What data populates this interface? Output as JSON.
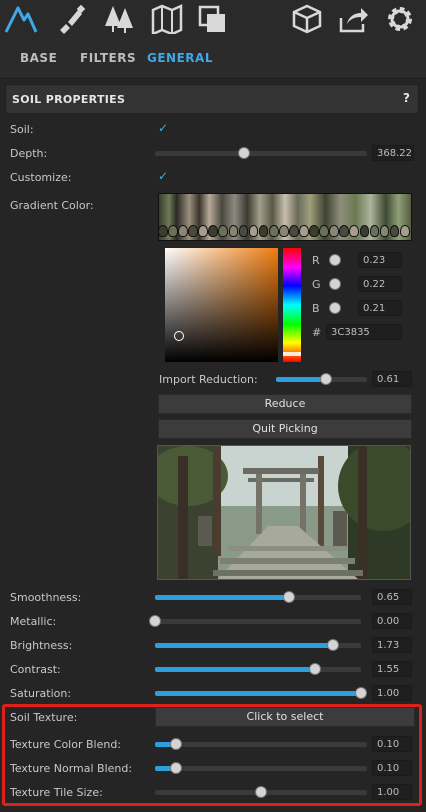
{
  "toolbar": {
    "icons": [
      "terrain-icon",
      "brush-icon",
      "trees-icon",
      "map-icon",
      "layers-icon",
      "cube-icon",
      "share-icon",
      "gear-icon"
    ]
  },
  "tabs": [
    {
      "label": "BASE",
      "active": false
    },
    {
      "label": "FILTERS",
      "active": false
    },
    {
      "label": "GENERAL",
      "active": true
    }
  ],
  "section": {
    "title": "SOIL PROPERTIES",
    "help": "?"
  },
  "soil": {
    "label": "Soil:",
    "checked": true
  },
  "depth": {
    "label": "Depth:",
    "value": "368.22",
    "fraction": 0.42
  },
  "customize": {
    "label": "Customize:",
    "checked": true
  },
  "gradient": {
    "label": "Gradient Color:"
  },
  "color": {
    "r_label": "R",
    "r": "0.23",
    "g_label": "G",
    "g": "0.22",
    "b_label": "B",
    "b": "0.21",
    "hex_label": "#",
    "hex": "3C3835"
  },
  "import_reduction": {
    "label": "Import Reduction:",
    "value": "0.61",
    "fraction": 0.55
  },
  "buttons": {
    "reduce": "Reduce",
    "quit": "Quit Picking"
  },
  "material": [
    {
      "label": "Smoothness:",
      "value": "0.65",
      "fraction": 0.65
    },
    {
      "label": "Metallic:",
      "value": "0.00",
      "fraction": 0.0
    },
    {
      "label": "Brightness:",
      "value": "1.73",
      "fraction": 0.865
    },
    {
      "label": "Contrast:",
      "value": "1.55",
      "fraction": 0.775
    },
    {
      "label": "Saturation:",
      "value": "1.00",
      "fraction": 1.0
    }
  ],
  "texture": {
    "label": "Soil Texture:",
    "button": "Click to select",
    "color_blend": {
      "label": "Texture Color Blend:",
      "value": "0.10",
      "fraction": 0.1
    },
    "normal_blend": {
      "label": "Texture Normal Blend:",
      "value": "0.10",
      "fraction": 0.1
    },
    "tile_size": {
      "label": "Texture Tile Size:",
      "value": "1.00",
      "fraction": 0.5
    }
  },
  "colors": {
    "accent": "#3ea9e6",
    "highlight": "#e0201b",
    "panel": "#252525"
  }
}
